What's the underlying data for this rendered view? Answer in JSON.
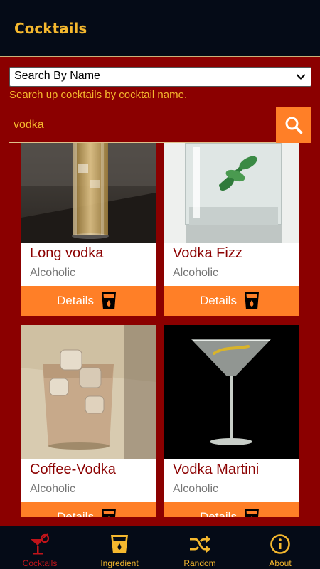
{
  "app": {
    "title": "Cocktails"
  },
  "search": {
    "mode": "Search By Name",
    "hint": "Search up cocktails by cocktail name.",
    "query": "vodka"
  },
  "cards": [
    {
      "name": "Long vodka",
      "category": "Alcoholic",
      "button": "Details"
    },
    {
      "name": "Vodka Fizz",
      "category": "Alcoholic",
      "button": "Details"
    },
    {
      "name": "Coffee-Vodka",
      "category": "Alcoholic",
      "button": "Details"
    },
    {
      "name": "Vodka Martini",
      "category": "Alcoholic",
      "button": "Details"
    }
  ],
  "nav": [
    {
      "label": "Cocktails",
      "icon": "cocktail-icon",
      "active": true
    },
    {
      "label": "Ingredient",
      "icon": "glass-icon",
      "active": false
    },
    {
      "label": "Random",
      "icon": "shuffle-icon",
      "active": false
    },
    {
      "label": "About",
      "icon": "info-icon",
      "active": false
    }
  ],
  "colors": {
    "accent": "#f5b82e",
    "orange": "#ff7f27",
    "background": "#8b0000",
    "bar": "#050b17",
    "active": "#c0141a"
  }
}
